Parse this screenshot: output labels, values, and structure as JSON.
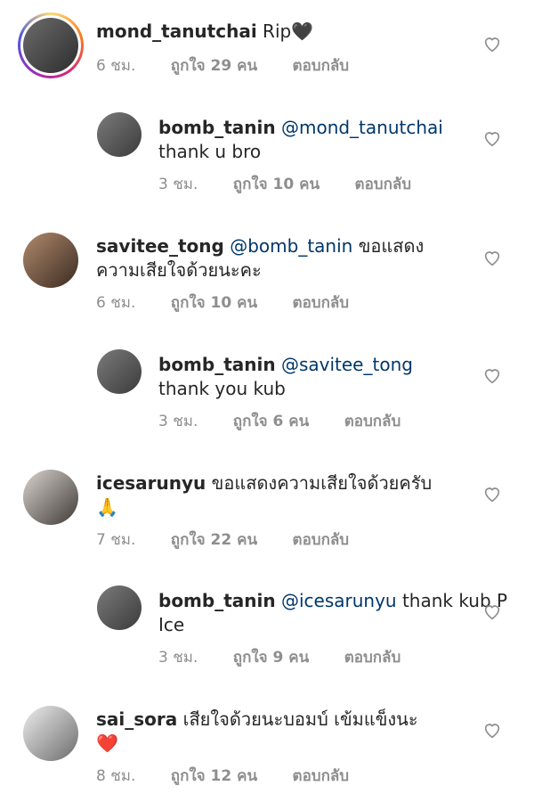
{
  "comments": [
    {
      "username": "mond_tanutchai",
      "mention": "",
      "text": "Rip",
      "emoji": "🖤",
      "time": "6 ชม.",
      "likes": "ถูกใจ 29 คน",
      "reply": "ตอบกลับ"
    },
    {
      "username": "bomb_tanin",
      "mention": "@mond_tanutchai",
      "text": "thank u bro",
      "emoji": "",
      "time": "3 ชม.",
      "likes": "ถูกใจ 10 คน",
      "reply": "ตอบกลับ"
    },
    {
      "username": "savitee_tong",
      "mention": "@bomb_tanin",
      "text": "ขอแสดงความเสียใจด้วยนะคะ",
      "emoji": "",
      "time": "6 ชม.",
      "likes": "ถูกใจ 10 คน",
      "reply": "ตอบกลับ"
    },
    {
      "username": "bomb_tanin",
      "mention": "@savitee_tong",
      "text": "thank you kub",
      "emoji": "",
      "time": "3 ชม.",
      "likes": "ถูกใจ 6 คน",
      "reply": "ตอบกลับ"
    },
    {
      "username": "icesarunyu",
      "mention": "",
      "text": "ขอแสดงความเสียใจด้วยครับ",
      "emoji": "🙏",
      "time": "7 ชม.",
      "likes": "ถูกใจ 22 คน",
      "reply": "ตอบกลับ"
    },
    {
      "username": "bomb_tanin",
      "mention": "@icesarunyu",
      "text": "thank kub P Ice",
      "emoji": "",
      "time": "3 ชม.",
      "likes": "ถูกใจ 9 คน",
      "reply": "ตอบกลับ"
    },
    {
      "username": "sai_sora",
      "mention": "",
      "text": "เสียใจด้วยนะบอมบ์ เข้มแข็งนะ",
      "emoji": "❤️",
      "time": "8 ชม.",
      "likes": "ถูกใจ 12 คน",
      "reply": "ตอบกลับ"
    }
  ]
}
